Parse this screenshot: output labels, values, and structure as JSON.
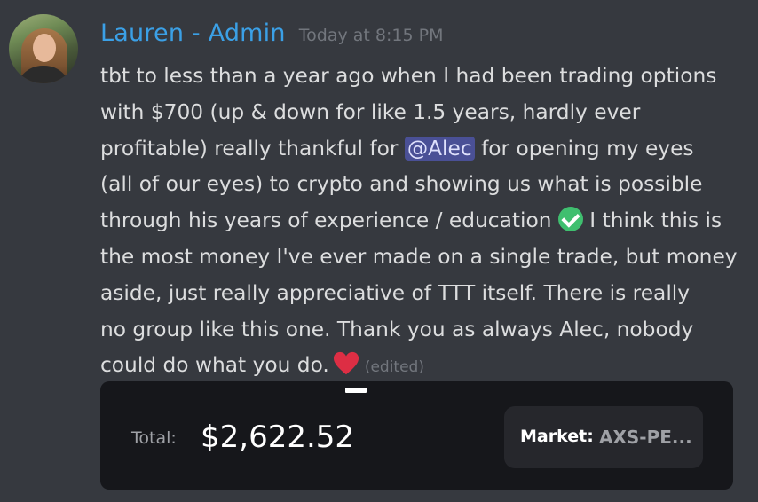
{
  "message": {
    "author": "Lauren - Admin",
    "timestamp": "Today at 8:15 PM",
    "author_color": "#3ba0e6",
    "lines": [
      "tbt to less than a year ago when I had been trading options",
      "with $700 (up & down for like 1.5 years, hardly ever",
      "profitable) really thankful for",
      "for opening my eyes",
      "(all of our eyes) to crypto and showing us what is possible",
      "through his years of experience / education",
      "I think this is",
      "the most money I've ever made on a single trade, but money",
      "aside, just really appreciative of TTT itself. There is really",
      "no group like this one. Thank you as always Alec, nobody",
      "could do what you do."
    ],
    "mention": "@Alec",
    "emojis": [
      "white-check-mark-icon",
      "red-heart-icon"
    ],
    "edited_label": "(edited)"
  },
  "card": {
    "total_label": "Total:",
    "total_value": "$2,622.52",
    "market_label": "Market:",
    "market_value": "AXS-PE..."
  }
}
